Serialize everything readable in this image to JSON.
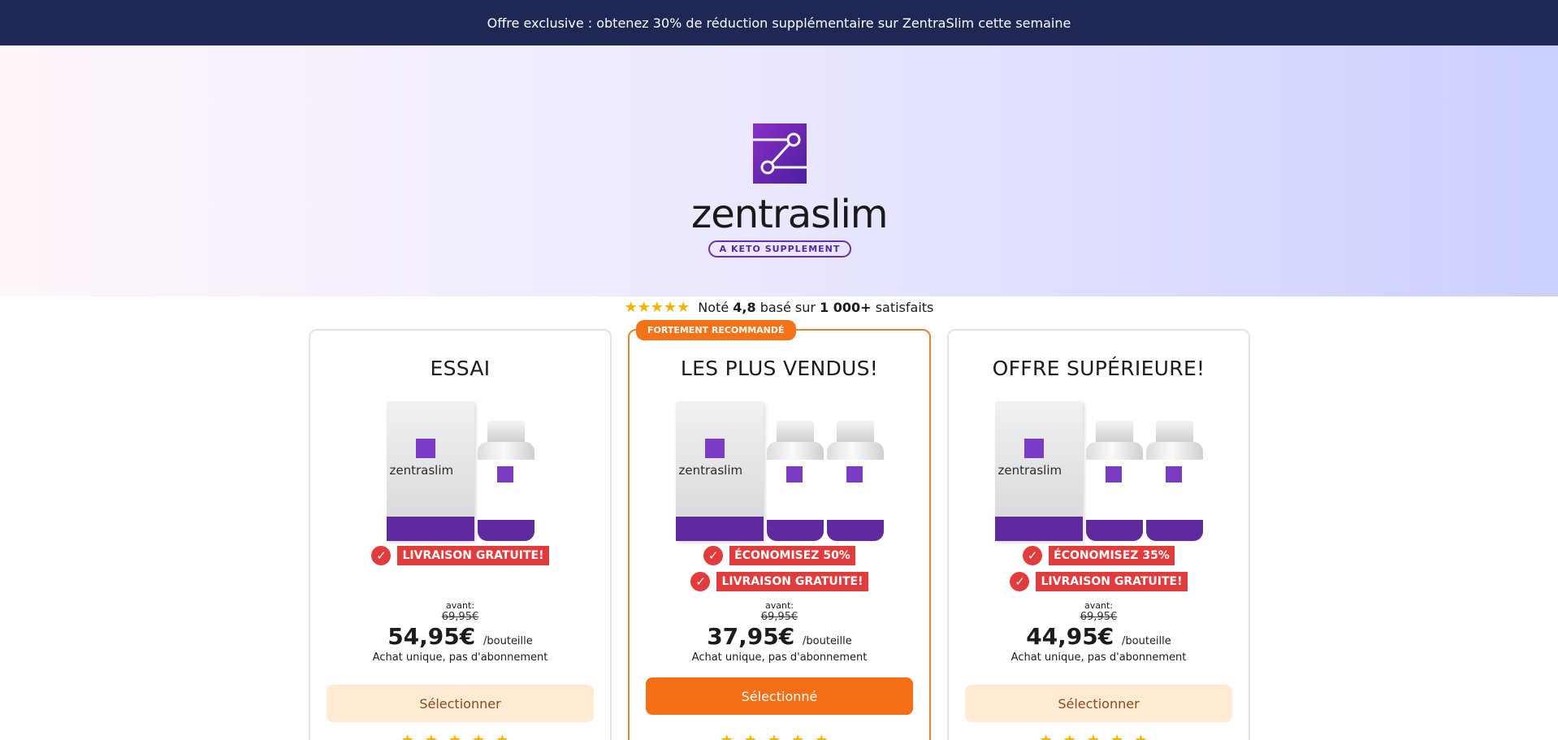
{
  "promo_bar": {
    "text": "Offre exclusive : obtenez 30% de réduction supplémentaire sur ZentraSlim cette semaine"
  },
  "brand": {
    "name": "zentraslim",
    "tagline": "A KETO SUPPLEMENT",
    "accent": "#6a2fb5"
  },
  "rating": {
    "stars": "★★★★★",
    "prefix": "Noté",
    "score": "4,8",
    "middle": "basé sur",
    "count": "1 000+",
    "suffix": "satisfaits"
  },
  "plans": [
    {
      "title": "ESSAI",
      "perks": [
        "LIVRAISON GRATUITE!"
      ],
      "before_label": "avant:",
      "old_price": "69,95€",
      "price": "54,95€",
      "unit": "/bouteille",
      "note": "Achat unique, pas d'abonnement",
      "button": "Sélectionner"
    },
    {
      "badge": "FORTEMENT RECOMMANDÉ",
      "title": "LES PLUS VENDUS!",
      "perks": [
        "ÉCONOMISEZ 50%",
        "LIVRAISON GRATUITE!"
      ],
      "before_label": "avant:",
      "old_price": "69,95€",
      "price": "37,95€",
      "unit": "/bouteille",
      "note": "Achat unique, pas d'abonnement",
      "button": "Sélectionné"
    },
    {
      "title": "OFFRE SUPÉRIEURE!",
      "perks": [
        "ÉCONOMISEZ 35%",
        "LIVRAISON GRATUITE!"
      ],
      "before_label": "avant:",
      "old_price": "69,95€",
      "price": "44,95€",
      "unit": "/bouteille",
      "note": "Achat unique, pas d'abonnement",
      "button": "Sélectionner"
    }
  ],
  "colors": {
    "promo_bg": "#1f2855",
    "cta": "#f66e15",
    "perk": "#e23b3b",
    "star": "#f5b300"
  }
}
